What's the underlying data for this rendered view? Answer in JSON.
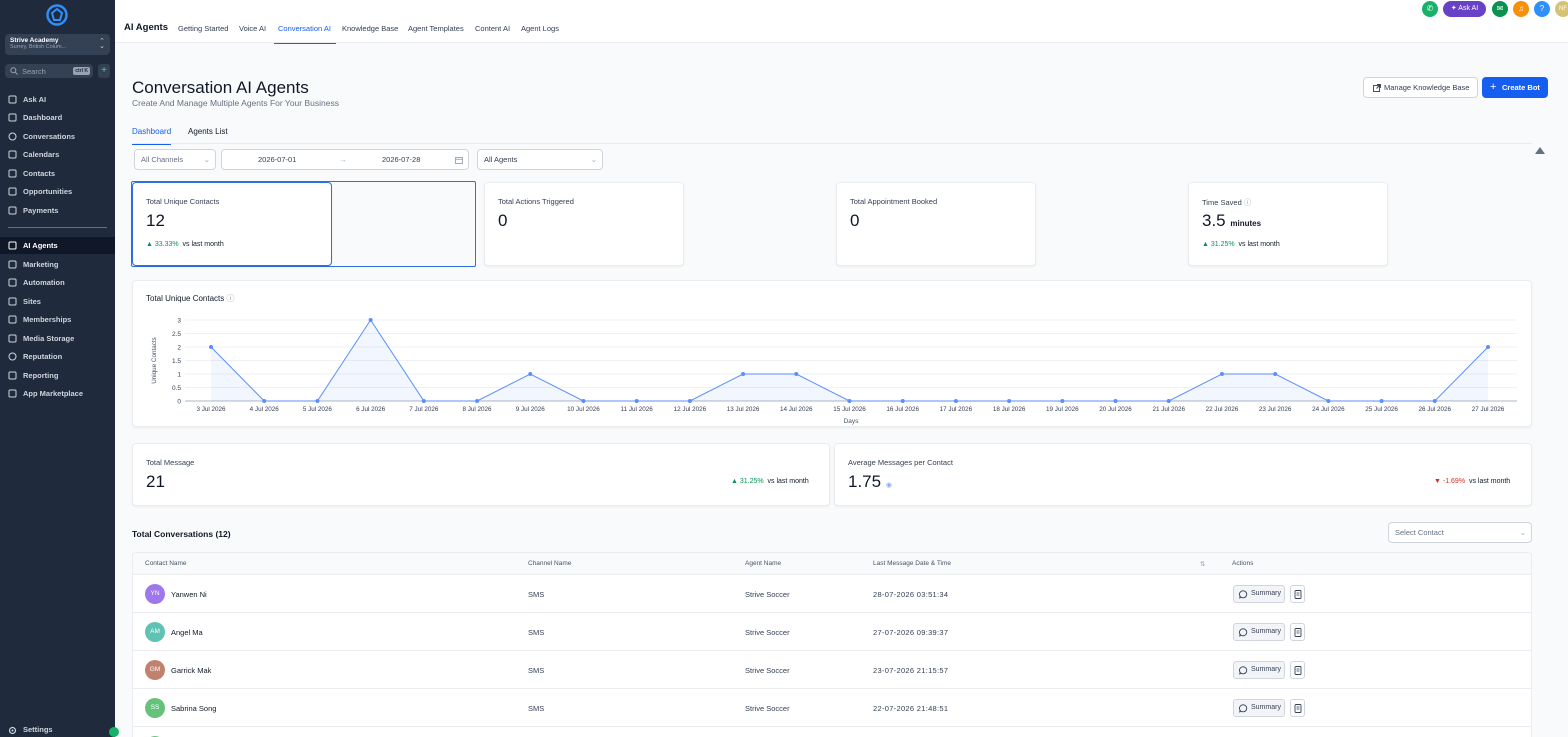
{
  "account": {
    "name": "Strive Academy",
    "location": "Surrey, British Colum..."
  },
  "search": {
    "placeholder": "Search",
    "shortcut": "ctrl K"
  },
  "sidebar": {
    "items": [
      {
        "label": "Ask AI",
        "icon": "sparkle-icon"
      },
      {
        "label": "Dashboard",
        "icon": "grid-icon"
      },
      {
        "label": "Conversations",
        "icon": "chat-bubble-icon"
      },
      {
        "label": "Calendars",
        "icon": "calendar-icon"
      },
      {
        "label": "Contacts",
        "icon": "contact-card-icon"
      },
      {
        "label": "Opportunities",
        "icon": "funnel-icon"
      },
      {
        "label": "Payments",
        "icon": "payments-icon"
      },
      {
        "label": "AI Agents",
        "icon": "ai-sparkle-icon",
        "active": true
      },
      {
        "label": "Marketing",
        "icon": "send-icon"
      },
      {
        "label": "Automation",
        "icon": "automation-icon"
      },
      {
        "label": "Sites",
        "icon": "sites-icon"
      },
      {
        "label": "Memberships",
        "icon": "membership-icon"
      },
      {
        "label": "Media Storage",
        "icon": "image-icon"
      },
      {
        "label": "Reputation",
        "icon": "star-icon"
      },
      {
        "label": "Reporting",
        "icon": "trend-icon"
      },
      {
        "label": "App Marketplace",
        "icon": "apps-icon"
      }
    ],
    "settings": "Settings"
  },
  "topbar": {
    "title": "AI Agents",
    "tabs": [
      "Getting Started",
      "Voice AI",
      "Conversation AI",
      "Knowledge Base",
      "Agent Templates",
      "Content AI",
      "Agent Logs"
    ],
    "active_tab": "Conversation AI",
    "ask_ai": "Ask AI",
    "help": "?",
    "user_initials": "NF"
  },
  "page": {
    "title": "Conversation AI Agents",
    "subtitle": "Create And Manage Multiple Agents For Your Business",
    "manage_kb": "Manage Knowledge Base",
    "create_bot": "Create Bot",
    "subtabs": [
      "Dashboard",
      "Agents List"
    ],
    "active_subtab": "Dashboard"
  },
  "filters": {
    "channels": "All Channels",
    "date_from": "2026-07-01",
    "date_to": "2026-07-28",
    "agents": "All Agents"
  },
  "stats": [
    {
      "label": "Total Unique Contacts",
      "value": "12",
      "change": "33.33%",
      "change_suffix": "vs last month"
    },
    {
      "label": "Total Actions Triggered",
      "value": "0"
    },
    {
      "label": "Total Appointment Booked",
      "value": "0"
    },
    {
      "label": "Time Saved",
      "value": "3.5",
      "unit": "minutes",
      "change": "31.25%",
      "change_suffix": "vs last month"
    }
  ],
  "chart_data": {
    "type": "line",
    "title": "Total Unique Contacts",
    "xlabel": "Days",
    "ylabel": "Unique Contacts",
    "ylim": [
      0,
      3
    ],
    "yticks": [
      "0",
      "0.5",
      "1",
      "1.5",
      "2",
      "2.5",
      "3"
    ],
    "grid": true,
    "color": "#5b8ff9",
    "categories": [
      "3 Jul 2026",
      "4 Jul 2026",
      "5 Jul 2026",
      "6 Jul 2026",
      "7 Jul 2026",
      "8 Jul 2026",
      "9 Jul 2026",
      "10 Jul 2026",
      "11 Jul 2026",
      "12 Jul 2026",
      "13 Jul 2026",
      "14 Jul 2026",
      "15 Jul 2026",
      "16 Jul 2026",
      "17 Jul 2026",
      "18 Jul 2026",
      "19 Jul 2026",
      "20 Jul 2026",
      "21 Jul 2026",
      "22 Jul 2026",
      "23 Jul 2026",
      "24 Jul 2026",
      "25 Jul 2026",
      "26 Jul 2026",
      "27 Jul 2026"
    ],
    "values": [
      2,
      0,
      0,
      3,
      0,
      0,
      1,
      0,
      0,
      0,
      1,
      1,
      0,
      0,
      0,
      0,
      0,
      0,
      0,
      1,
      1,
      0,
      0,
      0,
      2
    ]
  },
  "metrics": [
    {
      "label": "Total Message",
      "value": "21",
      "change": "31.25%",
      "direction": "up",
      "change_suffix": "vs last month"
    },
    {
      "label": "Average Messages per Contact",
      "value": "1.75",
      "change": "-1.69%",
      "direction": "down",
      "change_suffix": "vs last month"
    }
  ],
  "conversations": {
    "title": "Total Conversations (12)",
    "select_placeholder": "Select Contact",
    "columns": [
      "Contact Name",
      "Channel Name",
      "Agent Name",
      "Last Message Date & Time",
      "Actions"
    ],
    "summary_label": "Summary",
    "rows": [
      {
        "initials": "YN",
        "color": "#9e77ed",
        "name": "Yanwen Ni",
        "channel": "SMS",
        "agent": "Strive Soccer",
        "last": "28-07-2026 03:51:34"
      },
      {
        "initials": "AM",
        "color": "#5fc2b3",
        "name": "Angel Ma",
        "channel": "SMS",
        "agent": "Strive Soccer",
        "last": "27-07-2026 09:39:37"
      },
      {
        "initials": "GM",
        "color": "#c0826f",
        "name": "Garrick Mak",
        "channel": "SMS",
        "agent": "Strive Soccer",
        "last": "23-07-2026 21:15:57"
      },
      {
        "initials": "SS",
        "color": "#66c27a",
        "name": "Sabrina Song",
        "channel": "SMS",
        "agent": "Strive Soccer",
        "last": "22-07-2026 21:48:51"
      }
    ]
  }
}
